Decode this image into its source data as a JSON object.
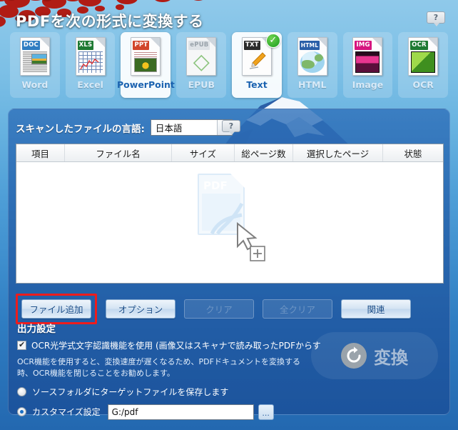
{
  "window": {
    "title": "PDFを次の形式に変換する"
  },
  "help": {
    "top_label": "?",
    "lang_label": "?"
  },
  "formats": {
    "items": [
      {
        "label": "Word",
        "badge": "DOC",
        "icon": "word-file-icon",
        "state": "normal"
      },
      {
        "label": "Excel",
        "badge": "XLS",
        "icon": "excel-file-icon",
        "state": "normal"
      },
      {
        "label": "PowerPoint",
        "badge": "PPT",
        "icon": "powerpoint-file-icon",
        "state": "hover"
      },
      {
        "label": "EPUB",
        "badge": "ePUB",
        "icon": "epub-file-icon",
        "state": "normal"
      },
      {
        "label": "Text",
        "badge": "TXT",
        "icon": "text-file-icon",
        "state": "selected"
      },
      {
        "label": "HTML",
        "badge": "HTML",
        "icon": "html-file-icon",
        "state": "normal"
      },
      {
        "label": "Image",
        "badge": "IMG",
        "icon": "image-file-icon",
        "state": "normal"
      },
      {
        "label": "OCR",
        "badge": "OCR",
        "icon": "ocr-file-icon",
        "state": "normal"
      }
    ]
  },
  "language": {
    "label": "スキャンしたファイルの言語:",
    "value": "日本語"
  },
  "table": {
    "columns": [
      "項目",
      "ファイル名",
      "サイズ",
      "総ページ数",
      "選択したページ",
      "状態"
    ],
    "rows": [],
    "empty_art": {
      "doc_label": "PDF",
      "hint_plus": "+"
    }
  },
  "buttons": {
    "add_file": "ファイル追加",
    "options": "オプション",
    "clear": "クリア",
    "clear_all": "全クリア",
    "related": "関連"
  },
  "output": {
    "title": "出力設定",
    "ocr_checkbox_label": "OCR光学式文字認識機能を使用 (画像又はスキャナで読み取ったPDFからす",
    "note": "OCR機能を使用すると、変換速度が遅くなるため、PDFドキュメントを変換する時、OCR機能を閉じることをお勧めします。",
    "radio_source_label": "ソースフォルダにターゲットファイルを保存します",
    "radio_custom_label": "カスタマイズ設定",
    "path_value": "G:/pdf",
    "browse_label": "..."
  },
  "convert": {
    "label": "変換",
    "icon": "refresh-circle-icon"
  },
  "colors": {
    "accent": "#1b6fc4",
    "highlight_box": "#ee1c1c",
    "panel": "#2663aa",
    "selected_check": "#199b1e"
  }
}
